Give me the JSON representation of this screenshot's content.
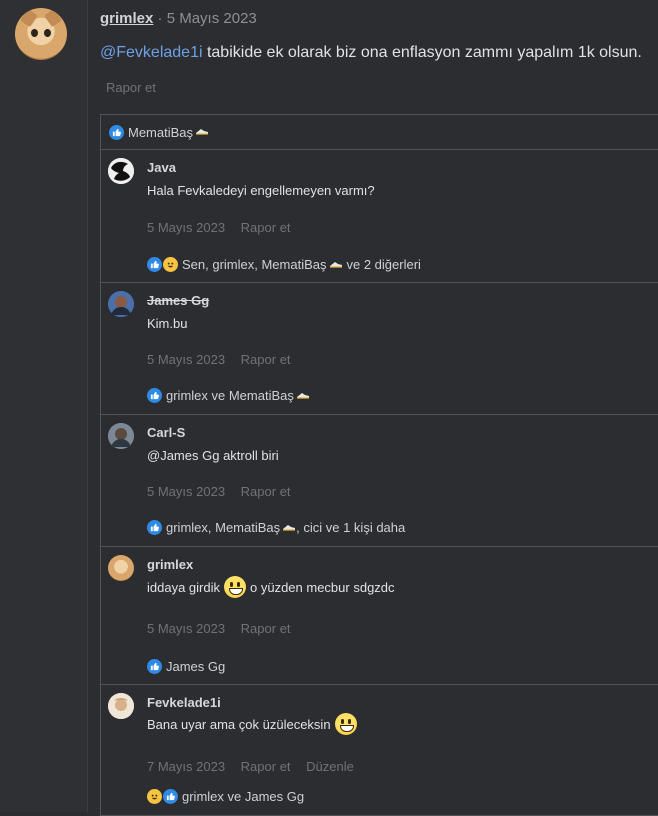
{
  "post": {
    "author": "grimlex",
    "separator": "·",
    "date": "5 Mayıs 2023",
    "mention": "@Fevkelade1i",
    "text": " tabikide ek olarak biz ona enflasyon zammı yapalım 1k olsun.",
    "report_label": "Rapor et"
  },
  "reaction_bar": {
    "names": "MematiBaş"
  },
  "comments": [
    {
      "author": "Java",
      "text": "Hala Fevkaledeyi engellemeyen varmı?",
      "date": "5 Mayıs 2023",
      "report": "Rapor et",
      "reactions": "Sen, grimlex, MematiBaş",
      "reactions_suffix": "ve 2 diğerleri"
    },
    {
      "author": "James Gg",
      "text": "Kim.bu",
      "date": "5 Mayıs 2023",
      "report": "Rapor et",
      "reactions": "grimlex ve MematiBaş"
    },
    {
      "author": "Carl-S",
      "text_mention": "@James Gg",
      "text": " aktroll biri",
      "date": "5 Mayıs 2023",
      "report": "Rapor et",
      "reactions": "grimlex, MematiBaş",
      "reactions_suffix": ", cici ve 1 kişi daha"
    },
    {
      "author": "grimlex",
      "text_before": "iddaya girdik",
      "text_after": "o yüzden mecbur sdgzdc",
      "date": "5 Mayıs 2023",
      "report": "Rapor et",
      "reactions": "James Gg"
    },
    {
      "author": "Fevkelade1i",
      "text_before": "Bana uyar ama çok üzüleceksin",
      "date": "7 Mayıs 2023",
      "report": "Rapor et",
      "edit": "Düzenle",
      "reactions": "grimlex ve James Gg"
    }
  ],
  "icons": {
    "like": "like-icon",
    "laugh": "laugh-icon",
    "shoe": "shoe-icon",
    "grin": "grinning-emoji"
  },
  "colors": {
    "background": "#2b2d30",
    "mention": "#6fa0e6",
    "like": "#2f8ae6",
    "border": "#505357"
  }
}
